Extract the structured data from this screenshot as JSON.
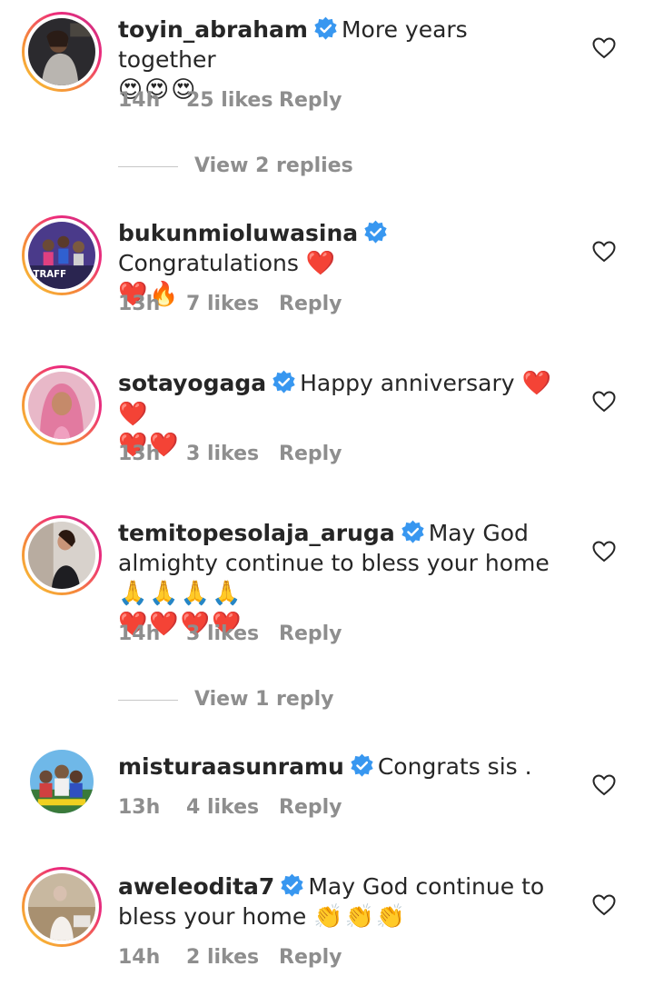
{
  "comments": [
    {
      "username": "toyin_abraham",
      "text": "More years together",
      "emoji": "😍😍😍",
      "time": "14h",
      "likes": "25 likes",
      "reply": "Reply",
      "verified": true
    },
    {
      "username": "bukunmioluwasina",
      "text": "Congratulations",
      "emoji": "❤️",
      "emoji2": "❤️🔥",
      "time": "13h",
      "likes": "7 likes",
      "reply": "Reply",
      "verified": true
    },
    {
      "username": "sotayogaga",
      "text": "Happy anniversary",
      "emoji": "❤️❤️",
      "emoji2": "❤️❤️",
      "time": "13h",
      "likes": "3 likes",
      "reply": "Reply",
      "verified": true
    },
    {
      "username": "temitopesolaja_aruga",
      "text": "May God almighty continue to bless your home",
      "emoji": "🙏🙏🙏🙏",
      "emoji2": "❤️❤️❤️❤️",
      "time": "14h",
      "likes": "3 likes",
      "reply": "Reply",
      "verified": true
    },
    {
      "username": "misturaasunramu",
      "text": "Congrats sis .",
      "time": "13h",
      "likes": "4 likes",
      "reply": "Reply",
      "verified": true
    },
    {
      "username": "aweleodita7",
      "text": "May God continue to bless your home",
      "emoji": "👏👏👏",
      "time": "14h",
      "likes": "2 likes",
      "reply": "Reply",
      "verified": true
    }
  ],
  "view_replies": [
    "View 2 replies",
    "View 1 reply"
  ],
  "colors": {
    "verified_blue": "#3897f0",
    "meta_gray": "#8e8e8e",
    "text": "#262626"
  },
  "icons": {
    "verified": "verified-badge-icon",
    "like": "heart-outline-icon"
  }
}
